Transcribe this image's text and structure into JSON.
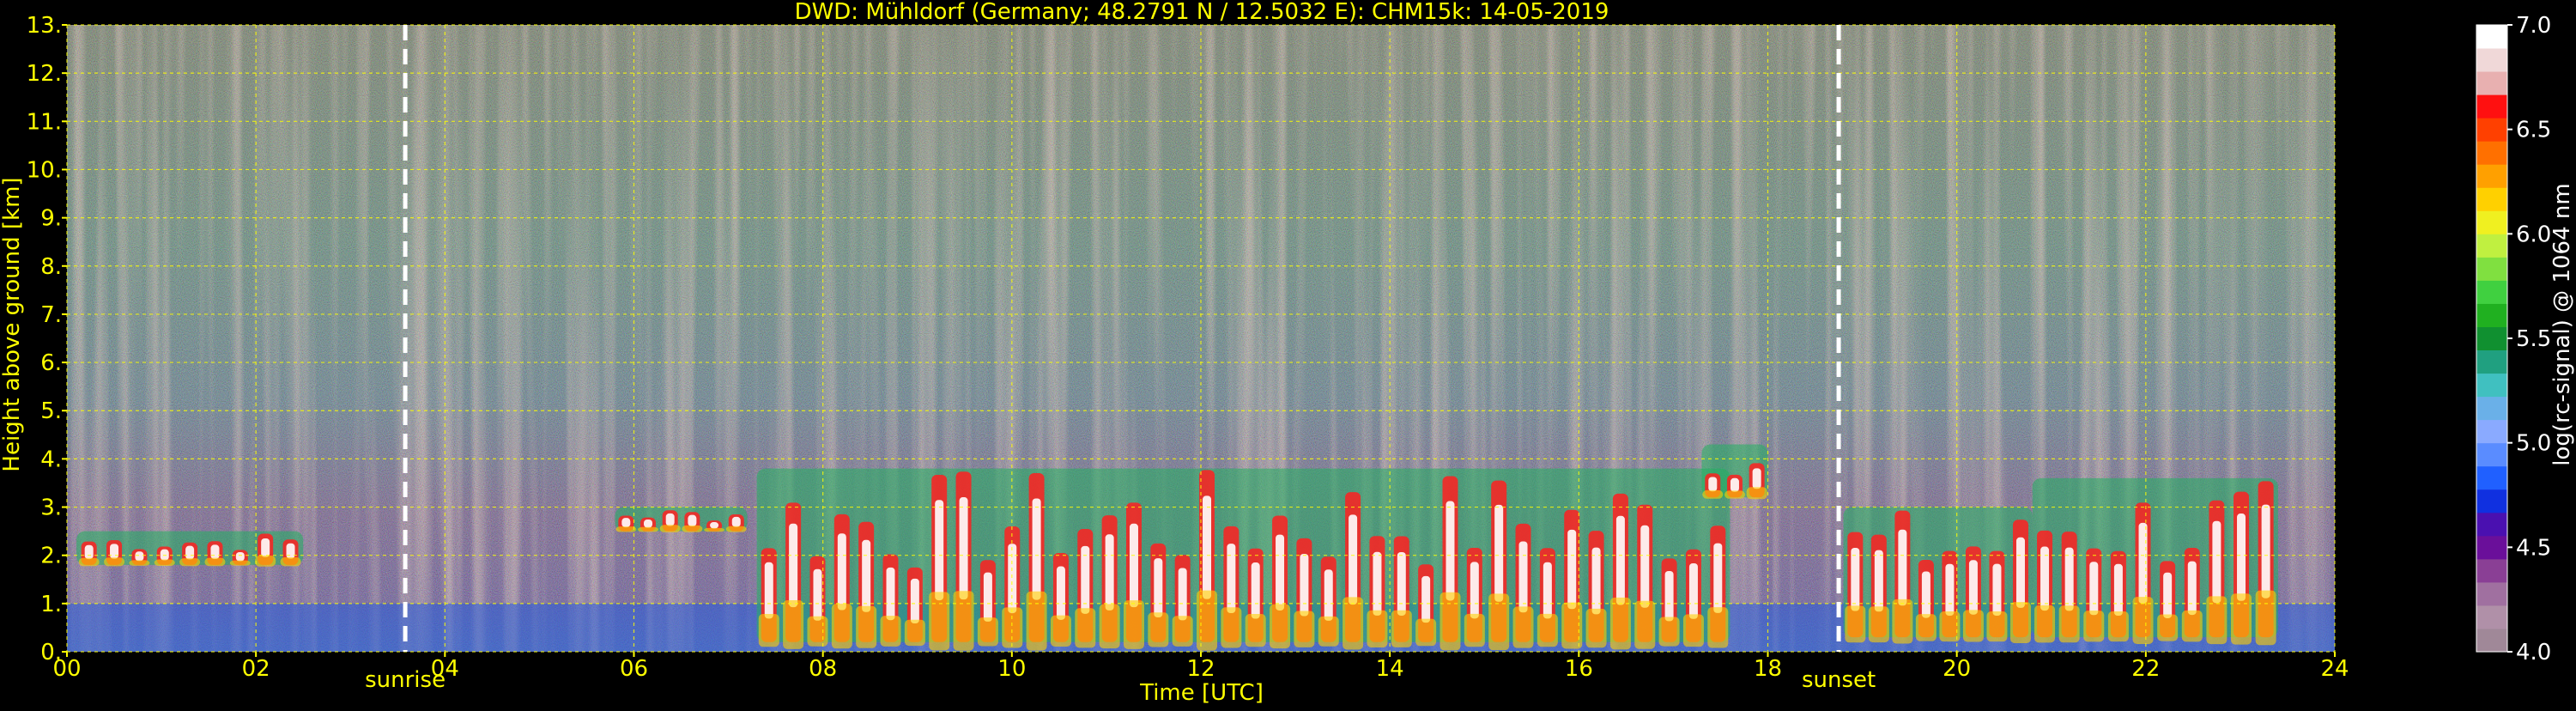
{
  "chart_data": {
    "type": "heatmap",
    "title": "DWD: Mühldorf (Germany; 48.2791 N / 12.5032 E):    CHM15k: 14-05-2019",
    "xlabel": "Time [UTC]",
    "ylabel": "Height above ground [km]",
    "x_range": [
      0,
      24
    ],
    "y_range": [
      0,
      13
    ],
    "x_ticks": [
      0,
      2,
      4,
      6,
      8,
      10,
      12,
      14,
      16,
      18,
      20,
      22,
      24
    ],
    "x_tick_labels": [
      "00",
      "02",
      "04",
      "06",
      "08",
      "10",
      "12",
      "14",
      "16",
      "18",
      "20",
      "22",
      "24"
    ],
    "y_ticks": [
      0,
      1,
      2,
      3,
      4,
      5,
      6,
      7,
      8,
      9,
      10,
      11,
      12,
      13
    ],
    "y_tick_labels": [
      "0.",
      "1.",
      "2.",
      "3.",
      "4.",
      "5.",
      "6.",
      "7.",
      "8.",
      "9.",
      "10.",
      "11.",
      "12.",
      "13."
    ],
    "grid": true,
    "colorbar": {
      "label": "log(rc-signal) @ 1064 nm",
      "range": [
        4.0,
        7.0
      ],
      "ticks": [
        4.0,
        4.5,
        5.0,
        5.5,
        6.0,
        6.5,
        7.0
      ],
      "tick_labels": [
        "4.0",
        "4.5",
        "5.0",
        "5.5",
        "6.0",
        "6.5",
        "7.0"
      ],
      "colors": [
        "#a08898",
        "#b090a8",
        "#a070a0",
        "#8a3f95",
        "#6a0f9a",
        "#4a10b0",
        "#1030e0",
        "#2060ff",
        "#5a8cff",
        "#8aaaff",
        "#6ab0e8",
        "#40c0c0",
        "#20a080",
        "#109030",
        "#20b020",
        "#40d040",
        "#80e040",
        "#c0f040",
        "#f0f020",
        "#ffd000",
        "#ffa000",
        "#ff7000",
        "#ff4000",
        "#ff1010",
        "#e8b0b0",
        "#f0d8d8",
        "#ffffff"
      ]
    },
    "events": [
      {
        "label": "sunrise",
        "time": 3.58
      },
      {
        "label": "sunset",
        "time": 18.75
      }
    ],
    "cloud_layers": [
      {
        "start": 0.1,
        "end": 2.5,
        "base_km": 1.8,
        "top_km": 2.5
      },
      {
        "start": 5.8,
        "end": 7.2,
        "base_km": 2.5,
        "top_km": 3.0
      },
      {
        "start": 7.3,
        "end": 17.6,
        "base_km": 0.2,
        "top_km": 3.8
      },
      {
        "start": 17.3,
        "end": 18.0,
        "base_km": 3.2,
        "top_km": 4.3
      },
      {
        "start": 18.8,
        "end": 20.8,
        "base_km": 0.3,
        "top_km": 3.0
      },
      {
        "start": 20.8,
        "end": 23.4,
        "base_km": 0.3,
        "top_km": 3.6
      }
    ],
    "colors": {
      "axis_text": "#ffff00",
      "grid": "#ffff00",
      "event_line": "#ffffff",
      "background": "#000000"
    }
  }
}
